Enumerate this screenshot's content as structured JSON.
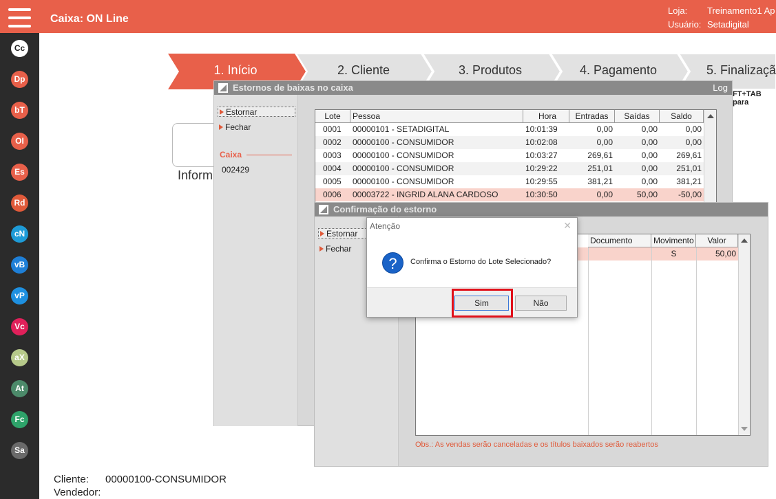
{
  "header": {
    "title": "Caixa: ON Line",
    "store_label": "Loja:",
    "store_value": "Treinamento1 Ap",
    "user_label": "Usuário:",
    "user_value": "Setadigital"
  },
  "sidebar": {
    "items": [
      {
        "label": "Cc",
        "color": "#ffffff",
        "text_color": "#222222"
      },
      {
        "label": "Dp",
        "color": "#e8604a"
      },
      {
        "label": "bT",
        "color": "#e8604a"
      },
      {
        "label": "OI",
        "color": "#e8604a"
      },
      {
        "label": "Es",
        "color": "#e8604a"
      },
      {
        "label": "Rd",
        "color": "#e05a3a"
      },
      {
        "label": "cN",
        "color": "#1e9bd7"
      },
      {
        "label": "vB",
        "color": "#1e7fd7"
      },
      {
        "label": "vP",
        "color": "#1e90e0"
      },
      {
        "label": "Vc",
        "color": "#e0205a"
      },
      {
        "label": "aX",
        "color": "#b6c98a"
      },
      {
        "label": "At",
        "color": "#4c8a6a"
      },
      {
        "label": "Fc",
        "color": "#2ea36a"
      },
      {
        "label": "Sa",
        "color": "#6a6a6a"
      }
    ]
  },
  "steps": [
    {
      "label": "1. Início",
      "active": true
    },
    {
      "label": "2. Cliente",
      "active": false
    },
    {
      "label": "3. Produtos",
      "active": false
    },
    {
      "label": "4. Pagamento",
      "active": false
    },
    {
      "label": "5. Finalizaçã",
      "active": false
    }
  ],
  "background": {
    "inform_text": "Inform",
    "shortcut_hint": "FT+TAB para",
    "client_label": "Cliente:",
    "client_value": "00000100-CONSUMIDOR",
    "seller_label": "Vendedor:"
  },
  "estornos_window": {
    "title": "Estornos de baixas no caixa",
    "log_label": "Log",
    "menu": [
      "Estornar",
      "Fechar"
    ],
    "caixa_label": "Caixa",
    "caixa_value": "002429",
    "columns": [
      "Lote",
      "Pessoa",
      "Hora",
      "Entradas",
      "Saídas",
      "Saldo"
    ],
    "rows": [
      [
        "0001",
        "00000101 - SETADIGITAL",
        "10:01:39",
        "0,00",
        "0,00",
        "0,00"
      ],
      [
        "0002",
        "00000100 - CONSUMIDOR",
        "10:02:08",
        "0,00",
        "0,00",
        "0,00"
      ],
      [
        "0003",
        "00000100 - CONSUMIDOR",
        "10:03:27",
        "269,61",
        "0,00",
        "269,61"
      ],
      [
        "0004",
        "00000100 - CONSUMIDOR",
        "10:29:22",
        "251,01",
        "0,00",
        "251,01"
      ],
      [
        "0005",
        "00000100 - CONSUMIDOR",
        "10:29:55",
        "381,21",
        "0,00",
        "381,21"
      ],
      [
        "0006",
        "00003722 - INGRID ALANA CARDOSO",
        "10:30:50",
        "0,00",
        "50,00",
        "-50,00"
      ]
    ]
  },
  "confirm_window": {
    "title": "Confirmação do estorno",
    "menu": [
      "Estornar",
      "Fechar"
    ],
    "columns": [
      "Documento",
      "Movimento",
      "Valor"
    ],
    "rows": [
      [
        "",
        "S",
        "50,00"
      ]
    ],
    "note": "Obs.: As vendas serão canceladas e os títulos baixados serão reabertos"
  },
  "dialog": {
    "title": "Atenção",
    "message": "Confirma o Estorno do Lote Selecionado?",
    "yes_label": "Sim",
    "no_label": "Não",
    "icon": "question-icon"
  }
}
